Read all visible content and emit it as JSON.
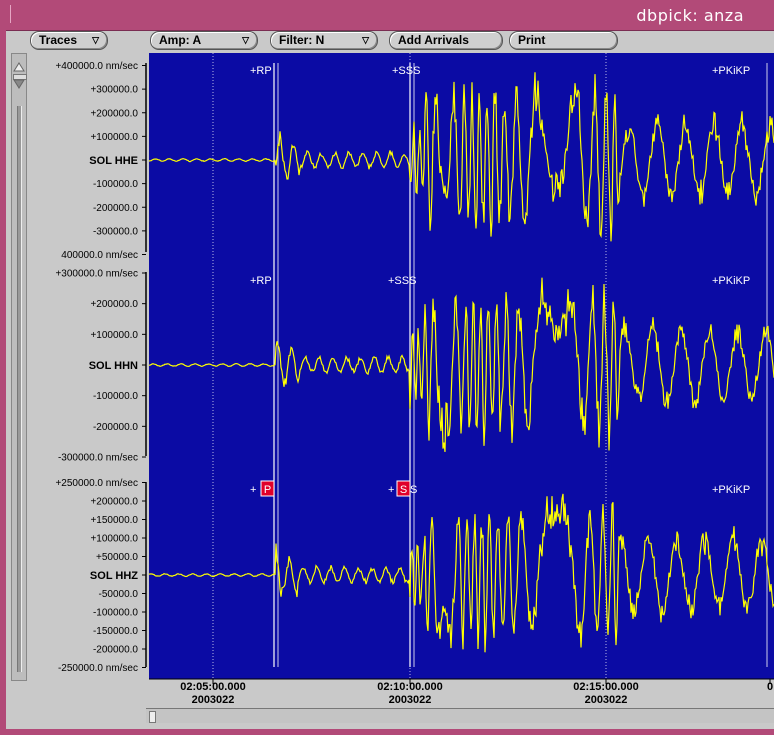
{
  "window": {
    "title": "dbpick: anza"
  },
  "toolbar": {
    "traces_label": "Traces",
    "amp_label": "Amp: A",
    "filter_label": "Filter: N",
    "add_arrivals_label": "Add Arrivals",
    "print_label": "Print"
  },
  "colors": {
    "plot_bg": "#0b0ba4",
    "trace": "#ffff00",
    "pick_box": "#e0002a",
    "title_bar": "#b24a78"
  },
  "icons": {
    "dropdown": "triangle-down-icon"
  },
  "traces": [
    {
      "station": "SOL HHE",
      "amp_labels": [
        "+400000.0 nm/sec",
        "+300000.0",
        "+200000.0",
        "+100000.0",
        "-100000.0",
        "-200000.0",
        "-300000.0",
        "400000.0 nm/sec"
      ],
      "amp_values": [
        400000,
        300000,
        200000,
        100000,
        -100000,
        -200000,
        -300000,
        -400000
      ],
      "phase_labels": [
        {
          "text": "+RP",
          "picked": false
        },
        {
          "text": "+SSS",
          "picked": false
        },
        {
          "text": "+PKiKP",
          "picked": false
        }
      ]
    },
    {
      "station": "SOL HHN",
      "amp_labels": [
        "+300000.0 nm/sec",
        "+200000.0",
        "+100000.0",
        "-100000.0",
        "-200000.0",
        "-300000.0 nm/sec"
      ],
      "amp_values": [
        300000,
        200000,
        100000,
        -100000,
        -200000,
        -300000
      ],
      "phase_labels": [
        {
          "text": "+RP",
          "picked": false
        },
        {
          "text": "+SSS",
          "picked": false
        },
        {
          "text": "+PKiKP",
          "picked": false
        }
      ]
    },
    {
      "station": "SOL HHZ",
      "amp_labels": [
        "+250000.0 nm/sec",
        "+200000.0",
        "+150000.0",
        "+100000.0",
        "+50000.0",
        "-50000.0",
        "-100000.0",
        "-150000.0",
        "-200000.0",
        "-250000.0 nm/sec"
      ],
      "amp_values": [
        250000,
        200000,
        150000,
        100000,
        50000,
        -50000,
        -100000,
        -150000,
        -200000,
        -250000
      ],
      "phase_labels": [
        {
          "text": "+",
          "picked": false
        },
        {
          "text": "P",
          "picked": true
        },
        {
          "text": "+",
          "picked": false
        },
        {
          "text": "S",
          "picked": true
        },
        {
          "text": "S",
          "picked": false
        },
        {
          "text": "+PKiKP",
          "picked": false
        }
      ]
    }
  ],
  "time_axis": {
    "ticks": [
      {
        "time": "02:05:00.000",
        "date": "2003022"
      },
      {
        "time": "02:10:00.000",
        "date": "2003022"
      },
      {
        "time": "02:15:00.000",
        "date": "2003022"
      },
      {
        "time": "0",
        "date": ""
      }
    ]
  }
}
